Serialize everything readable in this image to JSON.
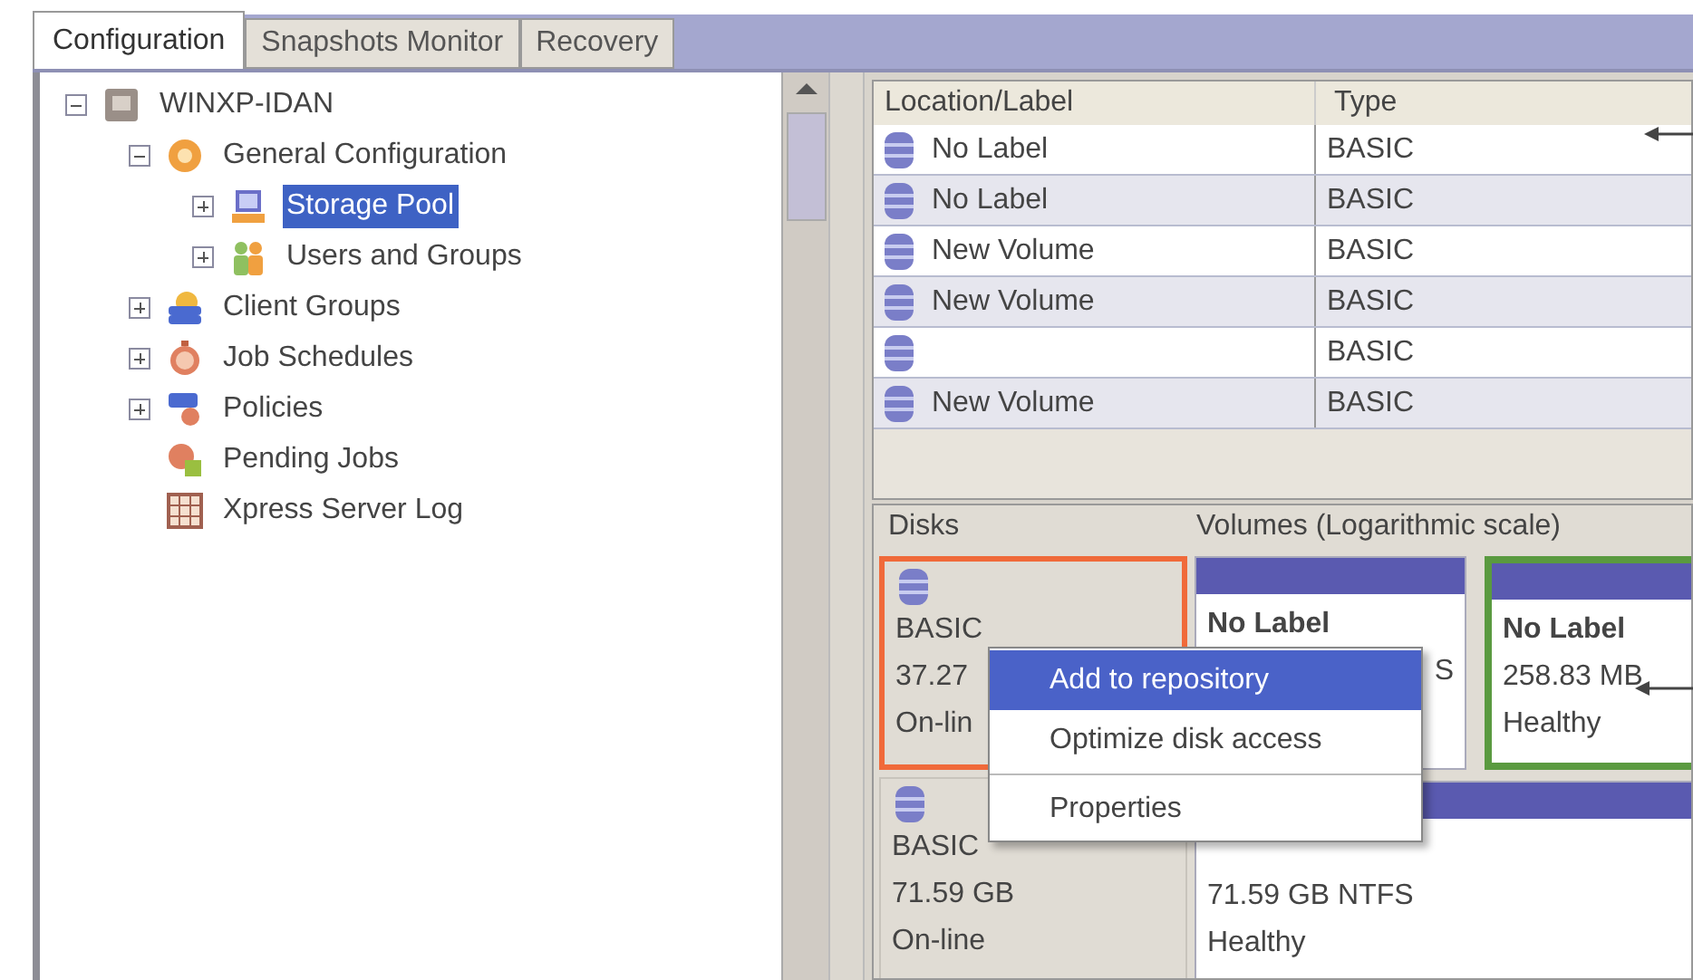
{
  "tabs": [
    {
      "label": "Configuration",
      "selected": true
    },
    {
      "label": "Snapshots Monitor",
      "selected": false
    },
    {
      "label": "Recovery",
      "selected": false
    }
  ],
  "tree": [
    {
      "label": "WINXP-IDAN",
      "kind": "computer",
      "expanded": true,
      "selected": false,
      "children": [
        {
          "label": "General Configuration",
          "kind": "gear",
          "expanded": true,
          "selected": false,
          "children": [
            {
              "label": "Storage Pool",
              "kind": "monitor",
              "expanded": false,
              "selected": true
            },
            {
              "label": "Users and Groups",
              "kind": "users",
              "expanded": false,
              "selected": false
            }
          ]
        },
        {
          "label": "Client Groups",
          "kind": "client",
          "expanded": false,
          "selected": false
        },
        {
          "label": "Job Schedules",
          "kind": "clock",
          "expanded": false,
          "selected": false
        },
        {
          "label": "Policies",
          "kind": "policy",
          "expanded": false,
          "selected": false
        },
        {
          "label": "Pending Jobs",
          "kind": "pending",
          "selected": false
        },
        {
          "label": "Xpress Server Log",
          "kind": "log",
          "selected": false
        }
      ]
    }
  ],
  "table": {
    "columns": [
      "Location/Label",
      "Type"
    ],
    "rows": [
      {
        "label": "No Label",
        "type": "BASIC"
      },
      {
        "label": "No Label",
        "type": "BASIC"
      },
      {
        "label": "New Volume",
        "type": "BASIC"
      },
      {
        "label": "New Volume",
        "type": "BASIC"
      },
      {
        "type": "BASIC"
      },
      {
        "label": "New Volume",
        "type": "BASIC"
      }
    ]
  },
  "disks_title": "Disks",
  "volumes_title": "Volumes (Logarithmic scale)",
  "disks": [
    {
      "type": "BASIC",
      "size": "37.27",
      "status": "On-lin",
      "selected": true
    },
    {
      "type": "BASIC",
      "size": "71.59 GB",
      "status": "On-line",
      "selected": false
    }
  ],
  "volumes": [
    {
      "title": "No Label",
      "lines": [
        "S"
      ],
      "selected": false
    },
    {
      "title": "No Label",
      "lines": [
        "258.83 MB",
        "Healthy"
      ],
      "selected": true
    },
    {
      "lines": [
        "71.59 GB NTFS",
        "Healthy"
      ],
      "selected": false
    }
  ],
  "context_menu": [
    {
      "kind": "item",
      "label": "Add to repository",
      "selected": true
    },
    {
      "kind": "item",
      "label": "Optimize disk access",
      "selected": false
    },
    {
      "kind": "separator"
    },
    {
      "kind": "item",
      "label": "Properties",
      "selected": false
    }
  ]
}
